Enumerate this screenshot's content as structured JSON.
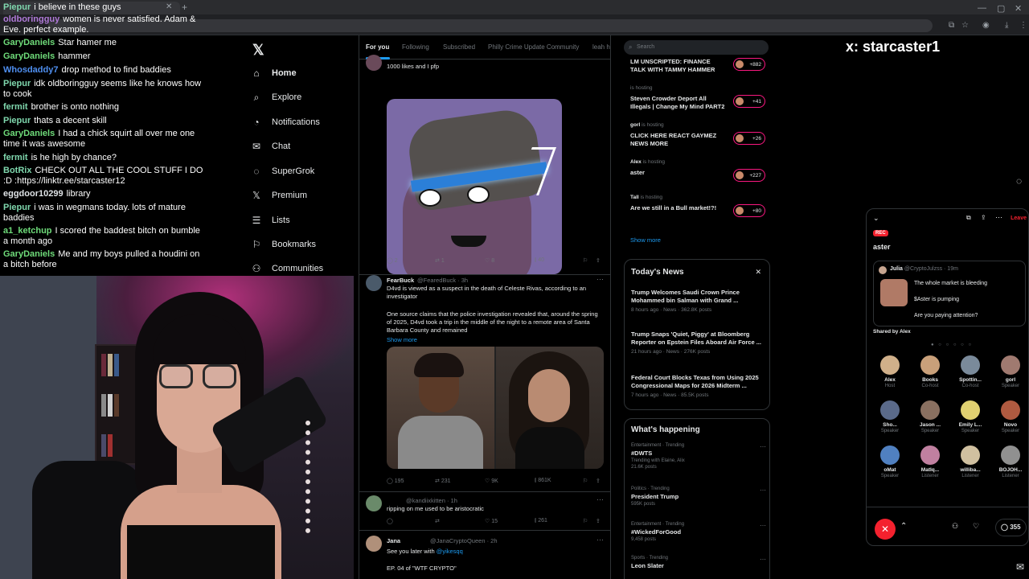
{
  "chat": {
    "messages": [
      {
        "user": "Piepur",
        "color": "#7fd7ad",
        "text": "i believe in these guys"
      },
      {
        "user": "oldboringguy",
        "color": "#b07ad8",
        "text": "women is never satisfied. Adam & Eve. perfect example."
      },
      {
        "user": "GaryDaniels",
        "color": "#6fdc7a",
        "text": "Star hamer me"
      },
      {
        "user": "GaryDaniels",
        "color": "#6fdc7a",
        "text": "hammer"
      },
      {
        "user": "Whosdaddy7",
        "color": "#4f8ff0",
        "text": "drop method to find baddies"
      },
      {
        "user": "Piepur",
        "color": "#7fd7ad",
        "text": "idk oldboringguy seems like he knows how to cook"
      },
      {
        "user": "fermit",
        "color": "#7fd7ad",
        "text": "brother is onto nothing"
      },
      {
        "user": "Piepur",
        "color": "#7fd7ad",
        "text": "thats a decent skill"
      },
      {
        "user": "GaryDaniels",
        "color": "#6fdc7a",
        "text": "I had a chick squirt all over me one time it was awesome"
      },
      {
        "user": "fermit",
        "color": "#7fd7ad",
        "text": "is he high by chance?"
      },
      {
        "user": "BotRix",
        "color": "#7fd7ad",
        "text": "CHECK OUT ALL THE COOL STUFF I DO :D :https://linktr.ee/starcaster12"
      },
      {
        "user": "eggdoor10299",
        "color": "#dfe3e6",
        "text": "library"
      },
      {
        "user": "Piepur",
        "color": "#7fd7ad",
        "text": "i was in wegmans today. lots of mature baddies"
      },
      {
        "user": "a1_ketchup",
        "color": "#6fdc7a",
        "text": "I scored the baddest bitch on bumble a month ago"
      },
      {
        "user": "GaryDaniels",
        "color": "#6fdc7a",
        "text": "Me and my boys pulled a houdini on a bitch before"
      }
    ]
  },
  "nav": {
    "items": [
      {
        "label": "Home",
        "icon": "home-icon",
        "glyph": "⌂"
      },
      {
        "label": "Explore",
        "icon": "search-icon",
        "glyph": "⌕"
      },
      {
        "label": "Notifications",
        "icon": "bell-icon",
        "glyph": "◔"
      },
      {
        "label": "Chat",
        "icon": "mail-icon",
        "glyph": "✉"
      },
      {
        "label": "SuperGrok",
        "icon": "grok-icon",
        "glyph": "◌"
      },
      {
        "label": "Premium",
        "icon": "x-premium-icon",
        "glyph": "𝕏"
      },
      {
        "label": "Lists",
        "icon": "list-icon",
        "glyph": "☰"
      },
      {
        "label": "Bookmarks",
        "icon": "bookmark-icon",
        "glyph": "⚐"
      },
      {
        "label": "Communities",
        "icon": "communities-icon",
        "glyph": "⚇"
      }
    ]
  },
  "timeline": {
    "tabs": [
      "For you",
      "Following",
      "Subscribed",
      "Philly Crime Update Community",
      "leah h"
    ],
    "tweet1": {
      "text": "1000 likes and I pfp",
      "replies": "2",
      "retweets": "1",
      "likes": "8",
      "views": "40"
    },
    "tweet2": {
      "name": "FearBuck",
      "handle": "@FearedBuck · 3h",
      "line1": "D4vd is viewed as a suspect in the death of Celeste Rivas, according to an investigator",
      "line2": "One source claims that the police investigation revealed that, around the spring of 2025, D4vd took a trip in the middle of the night to a remote area of Santa Barbara County and remained",
      "show_more": "Show more",
      "replies": "195",
      "retweets": "231",
      "likes": "9K",
      "views": "861K"
    },
    "tweet3": {
      "handle": "@kandiixkitten · 1h",
      "text": "ripping on me used to be aristocratic",
      "likes": "15",
      "views": "261"
    },
    "tweet4": {
      "name": "Jana",
      "handle": "@JanaCryptoQueen · 2h",
      "text_prefix": "See you later with ",
      "mention": "@yikesqq",
      "text2": "EP. 04 of \"WTF CRYPTO\""
    }
  },
  "right": {
    "search_placeholder": "Search",
    "spaces": [
      {
        "host": "",
        "title": "LM UNSCRIPTED: FINANCE TALK WITH TAMMY HAMMER",
        "count": "+882"
      },
      {
        "host": "is hosting",
        "title": "Steven Crowder Deport All Illegals | Change My Mind PART2",
        "count": "+41"
      },
      {
        "hostname": "gorl",
        "host": "is hosting",
        "title": "CLICK HERE REACT GAYMEZ NEWS MORE",
        "count": "+26"
      },
      {
        "hostname": "Alex",
        "host": "is hosting",
        "title": "aster",
        "count": "+227"
      },
      {
        "hostname": "Tall",
        "host": "is hosting",
        "title": "Are we still in a Bull market!?!",
        "count": "+80"
      }
    ],
    "show_more": "Show more",
    "news_title": "Today's News",
    "news": [
      {
        "headline": "Trump Welcomes Saudi Crown Prince Mohammed bin Salman with Grand ...",
        "meta": "8 hours ago · News · 362.8K posts"
      },
      {
        "headline": "Trump Snaps 'Quiet, Piggy' at Bloomberg Reporter on Epstein Files Aboard Air Force ...",
        "meta": "21 hours ago · News · 276K posts"
      },
      {
        "headline": "Federal Court Blocks Texas from Using 2025 Congressional Maps for 2026 Midterm ...",
        "meta": "7 hours ago · News · 85.5K posts"
      }
    ],
    "happening_title": "What's happening",
    "trends": [
      {
        "cat": "Entertainment · Trending",
        "name": "#DWTS",
        "posts": "Trending with Elaine, Alix",
        "posts2": "21.6K posts"
      },
      {
        "cat": "Politics · Trending",
        "name": "President Trump",
        "posts": "595K posts"
      },
      {
        "cat": "Entertainment · Trending",
        "name": "#WickedForGood",
        "posts": "9,458 posts"
      },
      {
        "cat": "Sports · Trending",
        "name": "Leon Slater",
        "posts": ""
      }
    ]
  },
  "caster": "x: starcaster1",
  "space_panel": {
    "leave": "Leave",
    "rec": "REC",
    "title": "aster",
    "pinned": {
      "name": "Julia",
      "handle": "@CryptoJulzss · 19m",
      "l1": "The whole market is bleeding",
      "l2": "$Aster is pumping",
      "l3": "Are you paying attention?"
    },
    "shared": "Shared by Alex",
    "listener_count": "355",
    "speakers": [
      {
        "name": "Alex",
        "role": "Host",
        "color": "#d0b08a"
      },
      {
        "name": "Books",
        "role": "Co-host",
        "color": "#c9a07a"
      },
      {
        "name": "Spottin...",
        "role": "Co-host",
        "color": "#7a8a9a"
      },
      {
        "name": "gorl",
        "role": "Speaker",
        "color": "#a07a70"
      },
      {
        "name": "Sho...",
        "role": "Speaker",
        "color": "#5a6a8a"
      },
      {
        "name": "Jason ...",
        "role": "Speaker",
        "color": "#8a7060"
      },
      {
        "name": "Emily L...",
        "role": "Speaker",
        "color": "#e0d070"
      },
      {
        "name": "Novo",
        "role": "Speaker",
        "color": "#b05a40"
      },
      {
        "name": "oMat",
        "role": "Speaker",
        "color": "#5080c0"
      },
      {
        "name": "MatIq...",
        "role": "Listener",
        "color": "#c080a0"
      },
      {
        "name": "williba...",
        "role": "Listener",
        "color": "#d0c0a0"
      },
      {
        "name": "BOJOH...",
        "role": "Listener",
        "color": "#909090"
      }
    ]
  }
}
